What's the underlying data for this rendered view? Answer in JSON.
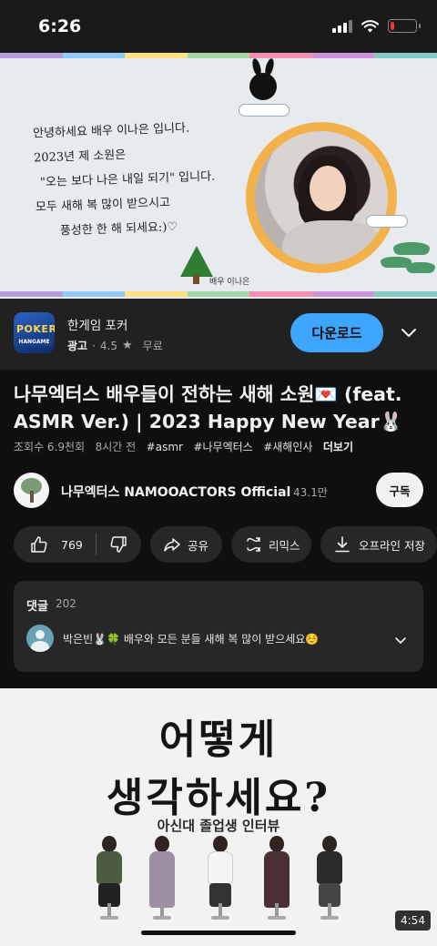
{
  "status_bar": {
    "time": "6:26",
    "battery_level": 0.15,
    "battery_color": "#e53935"
  },
  "hero": {
    "letter_lines": [
      "안녕하세요 배우 이나은 입니다.",
      "2023년 제 소원은",
      "\"오는 보다 나은 내일 되기\" 입니다.",
      "모두 새해 복 많이 받으시고",
      "풍성한 한 해 되세요:)♡"
    ],
    "signature": "배우 이나은",
    "stripe_colors": [
      "#b39ddb",
      "#90caf9",
      "#ffe082",
      "#a5d6a7",
      "#f48fb1",
      "#ce93d8",
      "#80cbc4"
    ]
  },
  "ad": {
    "logo_text_top": "POKER",
    "logo_text_bottom": "HANGAME",
    "title": "한게임 포커",
    "badge": "광고",
    "separator": "·",
    "rating": "4.5",
    "star_icon": "star-icon",
    "price": "무료",
    "download_label": "다운로드",
    "accent_color": "#3ea6ff"
  },
  "video": {
    "title": "나무엑터스 배우들이 전하는 새해 소원💌 (feat. ASMR Ver.) | 2023 Happy New Year🐰",
    "views": "조회수 6.9천회",
    "age": "8시간 전",
    "tags": [
      "#asmr",
      "#나무엑터스",
      "#새해인사"
    ],
    "more": "더보기"
  },
  "channel": {
    "name": "나무엑터스 NAMOOACTORS Official",
    "subscribers": "43.1만",
    "subscribe_label": "구독"
  },
  "actions": {
    "like_count": "769",
    "share_label": "공유",
    "remix_label": "리믹스",
    "offline_label": "오프라인 저장"
  },
  "comments": {
    "label": "댓글",
    "count": "202",
    "top_comment": "박은빈🐰🍀 배우와 모든 분들 새해 복 많이 받으세요☺️"
  },
  "next_video": {
    "line1": "어떻게",
    "line2": "생각하세요?",
    "subtitle": "아신대 졸업생 인터뷰",
    "duration": "4:54"
  }
}
